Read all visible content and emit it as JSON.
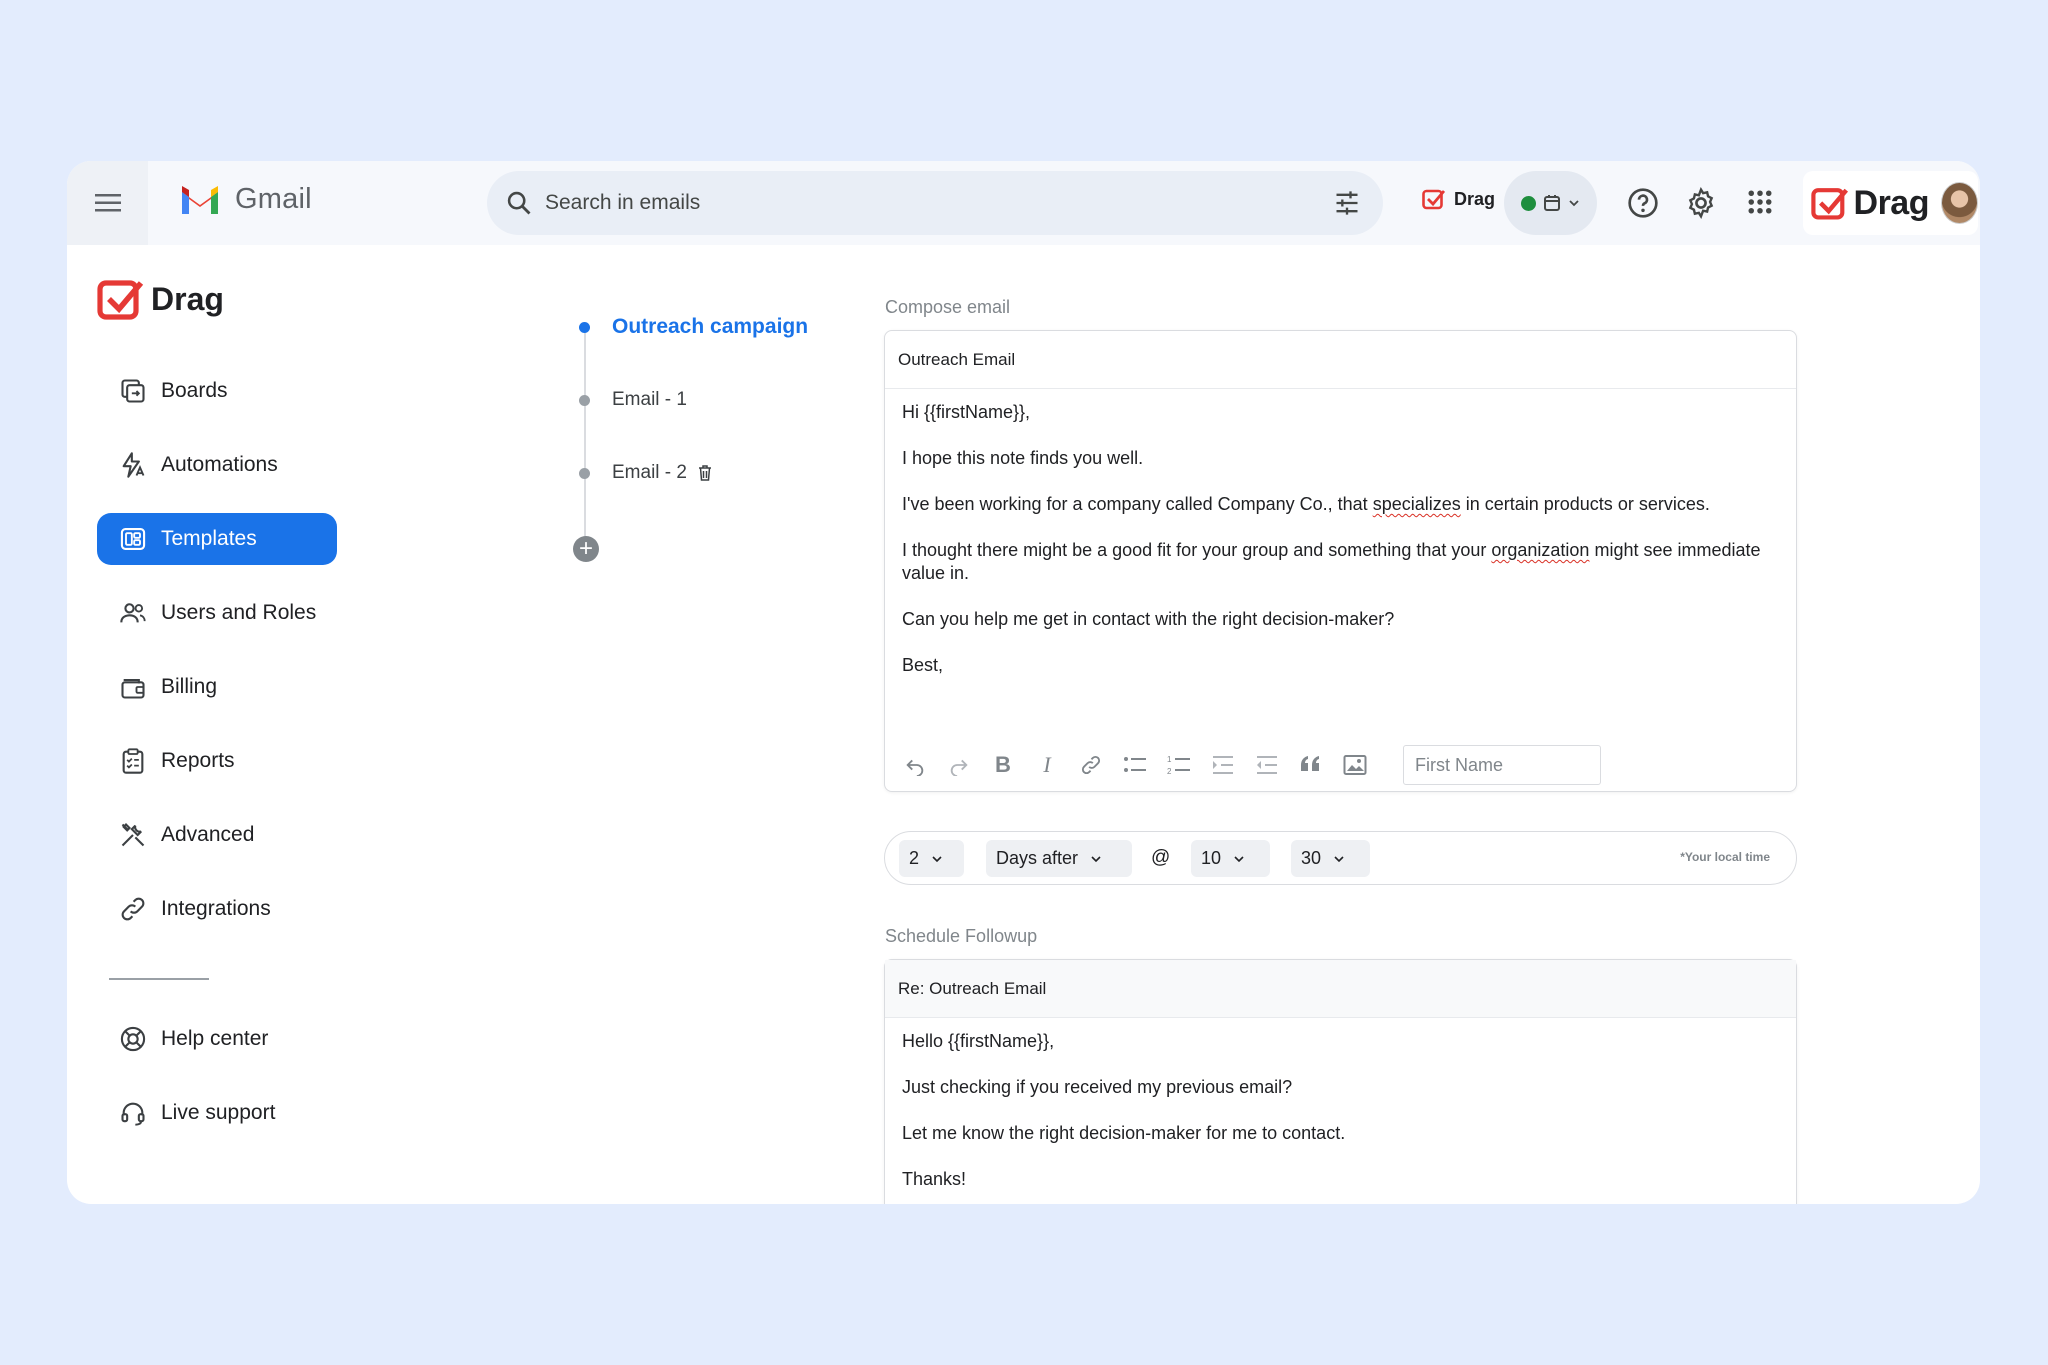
{
  "topbar": {
    "app_name": "Gmail",
    "search_placeholder": "Search in emails",
    "extension_label": "Drag",
    "brand_label": "Drag"
  },
  "sidebar": {
    "logo_text": "Drag",
    "items": [
      {
        "label": "Boards",
        "icon": "boards-icon",
        "active": false
      },
      {
        "label": "Automations",
        "icon": "automations-icon",
        "active": false
      },
      {
        "label": "Templates",
        "icon": "templates-icon",
        "active": true
      },
      {
        "label": "Users and Roles",
        "icon": "users-icon",
        "active": false
      },
      {
        "label": "Billing",
        "icon": "wallet-icon",
        "active": false
      },
      {
        "label": "Reports",
        "icon": "clipboard-icon",
        "active": false
      },
      {
        "label": "Advanced",
        "icon": "tools-icon",
        "active": false
      },
      {
        "label": "Integrations",
        "icon": "link-icon",
        "active": false
      }
    ],
    "footer_items": [
      {
        "label": "Help center",
        "icon": "lifebuoy-icon"
      },
      {
        "label": "Live support",
        "icon": "headset-icon"
      }
    ]
  },
  "steps": {
    "campaign": "Outreach campaign",
    "emails": [
      "Email - 1",
      "Email - 2"
    ]
  },
  "compose": {
    "section_label": "Compose email",
    "subject": "Outreach Email",
    "greeting": "Hi {{firstName}},",
    "line1": "I hope this note finds you well.",
    "line2_a": "I've been working for a company called Company Co., that ",
    "line2_spell": "specializes",
    "line2_b": " in certain products or services.",
    "line3_a": "I thought there might be a good fit for your group and something that your ",
    "line3_spell": "organization",
    "line3_b": " might see immediate value in.",
    "line4": "Can you help me get in contact with the right decision-maker?",
    "signoff": "Best,",
    "variable_placeholder": "First Name"
  },
  "schedule": {
    "days": "2",
    "relation": "Days after",
    "at": "@",
    "hour": "10",
    "minute": "30",
    "note": "*Your local time"
  },
  "followup": {
    "section_label": "Schedule Followup",
    "subject": "Re: Outreach Email",
    "greeting": "Hello {{firstName}},",
    "line1": "Just checking if you received my previous email?",
    "line2": "Let me know the right decision-maker for me to contact.",
    "signoff": "Thanks!"
  },
  "colors": {
    "accent": "#1a73e8",
    "brand_red": "#e53935",
    "status_green": "#1e8e3e",
    "background": "#e3ecfd"
  }
}
